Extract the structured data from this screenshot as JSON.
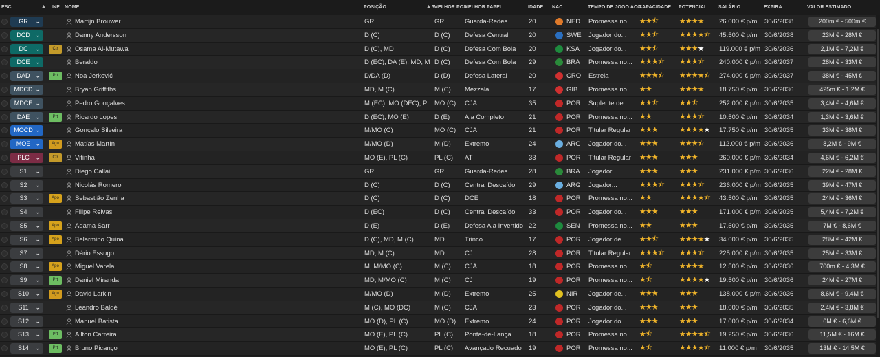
{
  "headers": {
    "esc": "ESC",
    "inf": "INF",
    "nome": "NOME",
    "posicao": "POSIÇÃO",
    "melhor_pos": "MELHOR POS",
    "melhor_papel": "MELHOR PAPEL",
    "idade": "IDADE",
    "nac": "NAC",
    "tempo": "TEMPO DE JOGO ACO...",
    "capacidade": "CAPACIDADE",
    "potencial": "POTENCIAL",
    "salario": "SALÁRIO",
    "expira": "EXPIRA",
    "valor": "VALOR ESTIMADO"
  },
  "colors": {
    "background": "#1e1e1e",
    "star": "#f0b42a",
    "pill_gk": "#1f3b52",
    "pill_def": "#0e6a66",
    "pill_mid": "#2267c4",
    "pill_att": "#7c2c45"
  },
  "players": [
    {
      "esc": "GR",
      "pill": "gk",
      "inf": "",
      "nome": "Martijn Brouwer",
      "posicao": "GR",
      "melhor_pos": "GR",
      "papel": "Guarda-Redes",
      "idade": "20",
      "nac": "NED",
      "flag": "#e07a2a",
      "tempo": "Promessa no...",
      "cap": [
        2,
        1,
        0
      ],
      "pot": [
        4,
        0,
        0
      ],
      "salario": "26.000 € p/m",
      "expira": "30/6/2038",
      "valor": "200m € - 500m €"
    },
    {
      "esc": "DCD",
      "pill": "def",
      "inf": "",
      "nome": "Danny Andersson",
      "posicao": "D (C)",
      "melhor_pos": "D (C)",
      "papel": "Defesa Central",
      "idade": "20",
      "nac": "SWE",
      "flag": "#2a6fc0",
      "tempo": "Jogador do...",
      "cap": [
        2,
        1,
        0
      ],
      "pot": [
        4,
        1,
        0
      ],
      "salario": "45.500 € p/m",
      "expira": "30/6/2038",
      "valor": "23M € - 28M €"
    },
    {
      "esc": "DC",
      "pill": "def",
      "inf": "Ctr",
      "inf_type": "ctr",
      "nome": "Osama Al-Mutawa",
      "posicao": "D (C), MD",
      "melhor_pos": "D (C)",
      "papel": "Defesa Com Bola",
      "idade": "20",
      "nac": "KSA",
      "flag": "#1e8a3e",
      "tempo": "Jogador do...",
      "cap": [
        2,
        1,
        0
      ],
      "pot": [
        3,
        0,
        1
      ],
      "salario": "119.000 € p/m",
      "expira": "30/6/2036",
      "valor": "2,1M € - 7,2M €"
    },
    {
      "esc": "DCE",
      "pill": "def",
      "inf": "",
      "nome": "Beraldo",
      "posicao": "D (EC), DA (E), MD, M (C)",
      "melhor_pos": "D (C)",
      "papel": "Defesa Com Bola",
      "idade": "29",
      "nac": "BRA",
      "flag": "#2a8a3a",
      "tempo": "Promessa no...",
      "cap": [
        3,
        1,
        0
      ],
      "pot": [
        3,
        1,
        0
      ],
      "salario": "240.000 € p/m",
      "expira": "30/6/2037",
      "valor": "28M € - 33M €"
    },
    {
      "esc": "DAD",
      "pill": "dm",
      "inf": "Prt",
      "inf_type": "prt",
      "nome": "Noa Jerković",
      "posicao": "D/DA (D)",
      "melhor_pos": "D (D)",
      "papel": "Defesa Lateral",
      "idade": "20",
      "nac": "CRO",
      "flag": "#d03030",
      "tempo": "Estrela",
      "cap": [
        3,
        1,
        0
      ],
      "pot": [
        4,
        1,
        0
      ],
      "salario": "274.000 € p/m",
      "expira": "30/6/2037",
      "valor": "38M € - 45M €"
    },
    {
      "esc": "MDCD",
      "pill": "dm",
      "inf": "",
      "nome": "Bryan Griffiths",
      "posicao": "MD, M (C)",
      "melhor_pos": "M (C)",
      "papel": "Mezzala",
      "idade": "17",
      "nac": "GIB",
      "flag": "#d03030",
      "tempo": "Promessa no...",
      "cap": [
        2,
        0,
        0
      ],
      "pot": [
        4,
        0,
        0
      ],
      "salario": "18.750 € p/m",
      "expira": "30/6/2036",
      "valor": "425m € - 1,2M €"
    },
    {
      "esc": "MDCE",
      "pill": "dm",
      "inf": "",
      "nome": "Pedro Gonçalves",
      "posicao": "M (EC), MO (DEC), PL (C)",
      "melhor_pos": "MO (C)",
      "papel": "CJA",
      "idade": "35",
      "nac": "POR",
      "flag": "#c02828",
      "tempo": "Suplente de...",
      "cap": [
        2,
        1,
        0
      ],
      "pot": [
        2,
        1,
        0
      ],
      "salario": "252.000 € p/m",
      "expira": "30/6/2035",
      "valor": "3,4M € - 4,6M €"
    },
    {
      "esc": "DAE",
      "pill": "dm",
      "inf": "Prt",
      "inf_type": "prt",
      "nome": "Ricardo Lopes",
      "posicao": "D (EC), MO (E)",
      "melhor_pos": "D (E)",
      "papel": "Ala Completo",
      "idade": "21",
      "nac": "POR",
      "flag": "#c02828",
      "tempo": "Promessa no...",
      "cap": [
        2,
        0,
        0
      ],
      "pot": [
        3,
        1,
        0
      ],
      "salario": "10.500 € p/m",
      "expira": "30/6/2034",
      "valor": "1,3M € - 3,6M €"
    },
    {
      "esc": "MOCD",
      "pill": "mid",
      "inf": "",
      "nome": "Gonçalo Silveira",
      "posicao": "M/MO (C)",
      "melhor_pos": "MO (C)",
      "papel": "CJA",
      "idade": "21",
      "nac": "POR",
      "flag": "#c02828",
      "tempo": "Titular Regular",
      "cap": [
        3,
        0,
        0
      ],
      "pot": [
        4,
        0,
        1
      ],
      "salario": "17.750 € p/m",
      "expira": "30/6/2035",
      "valor": "33M € - 38M €"
    },
    {
      "esc": "MOE",
      "pill": "mid",
      "inf": "Agu",
      "inf_type": "agu",
      "nome": "Matías Martín",
      "posicao": "M/MO (D)",
      "melhor_pos": "M (D)",
      "papel": "Extremo",
      "idade": "24",
      "nac": "ARG",
      "flag": "#6aaee0",
      "tempo": "Jogador do...",
      "cap": [
        3,
        0,
        0
      ],
      "pot": [
        3,
        1,
        0
      ],
      "salario": "112.000 € p/m",
      "expira": "30/6/2036",
      "valor": "8,2M € - 9M €"
    },
    {
      "esc": "PLC",
      "pill": "att",
      "inf": "Ctr",
      "inf_type": "ctr",
      "nome": "Vitinha",
      "posicao": "MO (E), PL (C)",
      "melhor_pos": "PL (C)",
      "papel": "AT",
      "idade": "33",
      "nac": "POR",
      "flag": "#c02828",
      "tempo": "Titular Regular",
      "cap": [
        3,
        0,
        0
      ],
      "pot": [
        3,
        0,
        0
      ],
      "salario": "260.000 € p/m",
      "expira": "30/6/2034",
      "valor": "4,6M € - 6,2M €"
    },
    {
      "esc": "S1",
      "pill": "sub",
      "inf": "",
      "nome": "Diego Callai",
      "posicao": "GR",
      "melhor_pos": "GR",
      "papel": "Guarda-Redes",
      "idade": "28",
      "nac": "BRA",
      "flag": "#2a8a3a",
      "tempo": "Jogador...",
      "cap": [
        3,
        0,
        0
      ],
      "pot": [
        3,
        0,
        0
      ],
      "salario": "231.000 € p/m",
      "expira": "30/6/2036",
      "valor": "22M € - 28M €"
    },
    {
      "esc": "S2",
      "pill": "sub",
      "inf": "",
      "nome": "Nicolás Romero",
      "posicao": "D (C)",
      "melhor_pos": "D (C)",
      "papel": "Central Descaído",
      "idade": "29",
      "nac": "ARG",
      "flag": "#6aaee0",
      "tempo": "Jogador...",
      "cap": [
        3,
        1,
        0
      ],
      "pot": [
        3,
        1,
        0
      ],
      "salario": "236.000 € p/m",
      "expira": "30/6/2035",
      "valor": "39M € - 47M €"
    },
    {
      "esc": "S3",
      "pill": "sub",
      "inf": "Apo",
      "inf_type": "apo",
      "nome": "Sebastião Zenha",
      "posicao": "D (C)",
      "melhor_pos": "D (C)",
      "papel": "DCE",
      "idade": "18",
      "nac": "POR",
      "flag": "#c02828",
      "tempo": "Promessa no...",
      "cap": [
        2,
        0,
        0
      ],
      "pot": [
        4,
        1,
        0
      ],
      "salario": "43.500 € p/m",
      "expira": "30/6/2035",
      "valor": "24M € - 36M €"
    },
    {
      "esc": "S4",
      "pill": "sub",
      "inf": "",
      "nome": "Filipe Relvas",
      "posicao": "D (EC)",
      "melhor_pos": "D (C)",
      "papel": "Central Descaído",
      "idade": "33",
      "nac": "POR",
      "flag": "#c02828",
      "tempo": "Jogador do...",
      "cap": [
        3,
        0,
        0
      ],
      "pot": [
        3,
        0,
        0
      ],
      "salario": "171.000 € p/m",
      "expira": "30/6/2035",
      "valor": "5,4M € - 7,2M €"
    },
    {
      "esc": "S5",
      "pill": "sub",
      "inf": "Apo",
      "inf_type": "apo",
      "nome": "Adama Sarr",
      "posicao": "D (E)",
      "melhor_pos": "D (E)",
      "papel": "Defesa Ala Invertido",
      "idade": "22",
      "nac": "SEN",
      "flag": "#1e8a3e",
      "tempo": "Promessa no...",
      "cap": [
        2,
        0,
        0
      ],
      "pot": [
        3,
        0,
        0
      ],
      "salario": "17.500 € p/m",
      "expira": "30/6/2035",
      "valor": "7M € - 8,6M €"
    },
    {
      "esc": "S6",
      "pill": "sub",
      "inf": "Apo",
      "inf_type": "apo",
      "nome": "Belarmino Quina",
      "posicao": "D (C), MD, M (C)",
      "melhor_pos": "MD",
      "papel": "Trinco",
      "idade": "17",
      "nac": "POR",
      "flag": "#c02828",
      "tempo": "Jogador de...",
      "cap": [
        2,
        1,
        0
      ],
      "pot": [
        4,
        0,
        1
      ],
      "salario": "34.000 € p/m",
      "expira": "30/6/2035",
      "valor": "28M € - 42M €"
    },
    {
      "esc": "S7",
      "pill": "sub",
      "inf": "",
      "nome": "Dário Essugo",
      "posicao": "MD, M (C)",
      "melhor_pos": "MD",
      "papel": "CJ",
      "idade": "28",
      "nac": "POR",
      "flag": "#c02828",
      "tempo": "Titular Regular",
      "cap": [
        3,
        1,
        0
      ],
      "pot": [
        3,
        1,
        0
      ],
      "salario": "225.000 € p/m",
      "expira": "30/6/2035",
      "valor": "25M € - 33M €"
    },
    {
      "esc": "S8",
      "pill": "sub",
      "inf": "Apo",
      "inf_type": "apo",
      "nome": "Miguel Varela",
      "posicao": "M, M/MO (C)",
      "melhor_pos": "M (C)",
      "papel": "CJA",
      "idade": "18",
      "nac": "POR",
      "flag": "#c02828",
      "tempo": "Promessa no...",
      "cap": [
        1,
        1,
        0
      ],
      "pot": [
        4,
        0,
        0
      ],
      "salario": "12.500 € p/m",
      "expira": "30/6/2036",
      "valor": "700m € - 4,3M €"
    },
    {
      "esc": "S9",
      "pill": "sub",
      "inf": "Prt",
      "inf_type": "prt",
      "nome": "Daniel Miranda",
      "posicao": "MD, M/MO (C)",
      "melhor_pos": "M (C)",
      "papel": "CJ",
      "idade": "19",
      "nac": "POR",
      "flag": "#c02828",
      "tempo": "Promessa no...",
      "cap": [
        1,
        1,
        0
      ],
      "pot": [
        4,
        0,
        1
      ],
      "salario": "19.500 € p/m",
      "expira": "30/6/2036",
      "valor": "24M € - 27M €"
    },
    {
      "esc": "S10",
      "pill": "sub",
      "inf": "Agu",
      "inf_type": "agu",
      "nome": "David Larkin",
      "posicao": "M/MO (D)",
      "melhor_pos": "M (D)",
      "papel": "Extremo",
      "idade": "25",
      "nac": "NIR",
      "flag": "#e0c020",
      "tempo": "Jogador de...",
      "cap": [
        3,
        0,
        0
      ],
      "pot": [
        3,
        0,
        0
      ],
      "salario": "138.000 € p/m",
      "expira": "30/6/2036",
      "valor": "8,6M € - 9,4M €"
    },
    {
      "esc": "S11",
      "pill": "sub",
      "inf": "",
      "nome": "Leandro Baldé",
      "posicao": "M (C), MO (DC)",
      "melhor_pos": "M (C)",
      "papel": "CJA",
      "idade": "23",
      "nac": "POR",
      "flag": "#c02828",
      "tempo": "Jogador do...",
      "cap": [
        3,
        0,
        0
      ],
      "pot": [
        3,
        0,
        0
      ],
      "salario": "18.000 € p/m",
      "expira": "30/6/2035",
      "valor": "2,4M € - 3,8M €"
    },
    {
      "esc": "S12",
      "pill": "sub",
      "inf": "",
      "nome": "Manuel Batista",
      "posicao": "MO (D), PL (C)",
      "melhor_pos": "MO (D)",
      "papel": "Extremo",
      "idade": "24",
      "nac": "POR",
      "flag": "#c02828",
      "tempo": "Jogador do...",
      "cap": [
        3,
        0,
        0
      ],
      "pot": [
        3,
        0,
        0
      ],
      "salario": "17.000 € p/m",
      "expira": "30/6/2034",
      "valor": "6M € - 6,6M €"
    },
    {
      "esc": "S13",
      "pill": "sub",
      "inf": "Prt",
      "inf_type": "prt",
      "nome": "Ailton Carreira",
      "posicao": "MO (E), PL (C)",
      "melhor_pos": "PL (C)",
      "papel": "Ponta-de-Lança",
      "idade": "18",
      "nac": "POR",
      "flag": "#c02828",
      "tempo": "Promessa no...",
      "cap": [
        1,
        1,
        0
      ],
      "pot": [
        4,
        1,
        0
      ],
      "salario": "19.250 € p/m",
      "expira": "30/6/2036",
      "valor": "11,5M € - 16M €"
    },
    {
      "esc": "S14",
      "pill": "sub",
      "inf": "Prt",
      "inf_type": "prt",
      "nome": "Bruno Picanço",
      "posicao": "MO (E), PL (C)",
      "melhor_pos": "PL (C)",
      "papel": "Avançado Recuado",
      "idade": "19",
      "nac": "POR",
      "flag": "#c02828",
      "tempo": "Promessa no...",
      "cap": [
        1,
        1,
        0
      ],
      "pot": [
        4,
        1,
        0
      ],
      "salario": "11.000 € p/m",
      "expira": "30/6/2035",
      "valor": "13M € - 14,5M €"
    }
  ]
}
